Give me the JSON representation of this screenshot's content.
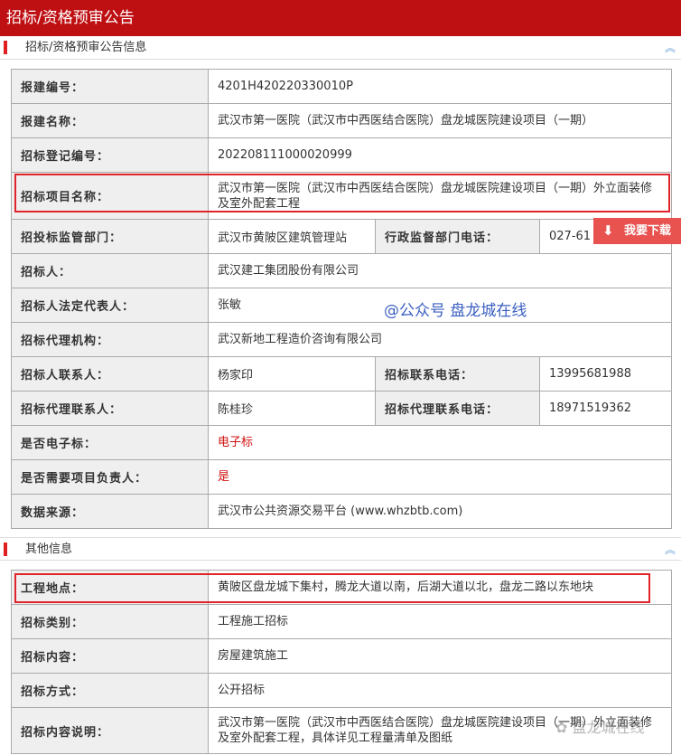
{
  "title": "招标/资格预审公告",
  "section1": "招标/资格预审公告信息",
  "section2": "其他信息",
  "rows1": [
    {
      "label": "报建编号：",
      "value": "4201H420220330010P"
    },
    {
      "label": "报建名称：",
      "value": "武汉市第一医院（武汉市中西医结合医院）盘龙城医院建设项目（一期）"
    },
    {
      "label": "招标登记编号：",
      "value": "202208111000020999"
    },
    {
      "label": "招标项目名称：",
      "value": "武汉市第一医院（武汉市中西医结合医院）盘龙城医院建设项目（一期）外立面装修及室外配套工程"
    },
    {
      "label": "招投标监管部门：",
      "value": "武汉市黄陂区建筑管理站",
      "label2": "行政监督部门电话：",
      "value2": "027-61"
    },
    {
      "label": "招标人：",
      "value": "武汉建工集团股份有限公司"
    },
    {
      "label": "招标人法定代表人：",
      "value": "张敏"
    },
    {
      "label": "招标代理机构：",
      "value": "武汉新地工程造价咨询有限公司"
    },
    {
      "label": "招标人联系人：",
      "value": "杨家印",
      "label2": "招标联系电话：",
      "value2": "13995681988"
    },
    {
      "label": "招标代理联系人：",
      "value": "陈桂珍",
      "label2": "招标代理联系电话：",
      "value2": "18971519362"
    },
    {
      "label": "是否电子标：",
      "value": "电子标"
    },
    {
      "label": "是否需要项目负责人：",
      "value": "是"
    },
    {
      "label": "数据来源：",
      "value": "武汉市公共资源交易平台 (www.whzbtb.com)"
    }
  ],
  "rows2": [
    {
      "label": "工程地点：",
      "value": "黄陂区盘龙城下集村，腾龙大道以南，后湖大道以北，盘龙二路以东地块"
    },
    {
      "label": "招标类别：",
      "value": "工程施工招标"
    },
    {
      "label": "招标内容：",
      "value": "房屋建筑施工"
    },
    {
      "label": "招标方式：",
      "value": "公开招标"
    },
    {
      "label": "招标内容说明：",
      "value": "武汉市第一医院（武汉市中西医结合医院）盘龙城医院建设项目（一期）外立面装修及室外配套工程，具体详见工程量清单及图纸"
    }
  ],
  "download_label": "我要下载",
  "watermark": "@公众号 盘龙城在线",
  "watermark2": "盘龙城在线"
}
